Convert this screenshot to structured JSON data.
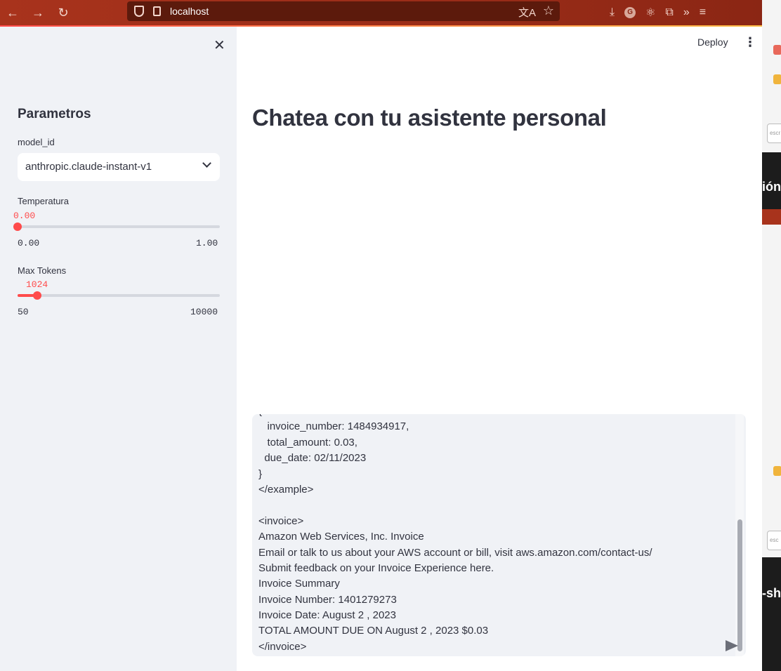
{
  "browser": {
    "url": "localhost",
    "nav_back": "←",
    "nav_forward": "→",
    "reload": "↻",
    "translate_icon": "文A",
    "star_icon": "☆",
    "tools": [
      "⤓",
      "G",
      "⚛",
      "⧉",
      "»",
      "≡"
    ]
  },
  "sidebar": {
    "close_label": "✕",
    "heading": "Parametros",
    "model_label": "model_id",
    "model_value": "anthropic.claude-instant-v1",
    "temperature": {
      "label": "Temperatura",
      "value": "0.00",
      "min": "0.00",
      "max": "1.00",
      "fraction": 0.0
    },
    "max_tokens": {
      "label": "Max Tokens",
      "value": "1024",
      "min": "50",
      "max": "10000",
      "fraction": 0.098
    }
  },
  "header": {
    "deploy_label": "Deploy",
    "menu_label": "⋮"
  },
  "main": {
    "title": "Chatea con tu asistente personal"
  },
  "chat_input": {
    "lines": [
      "{",
      "   invoice_number: 1484934917,",
      "   total_amount: 0.03,",
      "  due_date: 02/11/2023",
      "}",
      "</example>",
      "",
      "<invoice>",
      "Amazon Web Services, Inc. Invoice",
      "Email or talk to us about your AWS account or bill, visit aws.amazon.com/contact-us/",
      "Submit feedback on your Invoice Experience here.",
      "Invoice Summary",
      "Invoice Number: 1401279273",
      "Invoice Date: August 2 , 2023",
      "TOTAL AMOUNT DUE ON August 2 , 2023 $0.03",
      "</invoice>"
    ]
  },
  "edge": {
    "text_1": "ión",
    "text_2": "-sh",
    "input_1": "escr",
    "input_2": "esc"
  }
}
